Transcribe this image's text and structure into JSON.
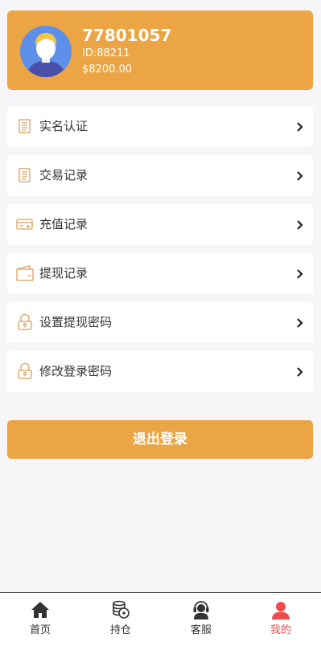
{
  "profile": {
    "username": "77801057",
    "id_text": "ID:88211",
    "balance": "$8200.00"
  },
  "menu": [
    {
      "label": "实名认证",
      "icon": "document-icon"
    },
    {
      "label": "交易记录",
      "icon": "document-icon"
    },
    {
      "label": "充值记录",
      "icon": "card-icon"
    },
    {
      "label": "提现记录",
      "icon": "wallet-icon"
    },
    {
      "label": "设置提现密码",
      "icon": "lock-icon"
    },
    {
      "label": "修改登录密码",
      "icon": "lock-icon"
    }
  ],
  "logout_label": "退出登录",
  "tabs": [
    {
      "label": "首页",
      "icon": "home-icon"
    },
    {
      "label": "持仓",
      "icon": "coins-icon"
    },
    {
      "label": "客服",
      "icon": "support-icon"
    },
    {
      "label": "我的",
      "icon": "user-icon",
      "active": true
    }
  ],
  "colors": {
    "accent": "#eba544",
    "active_tab": "#ef4b4b",
    "background": "#f6f5f8"
  }
}
